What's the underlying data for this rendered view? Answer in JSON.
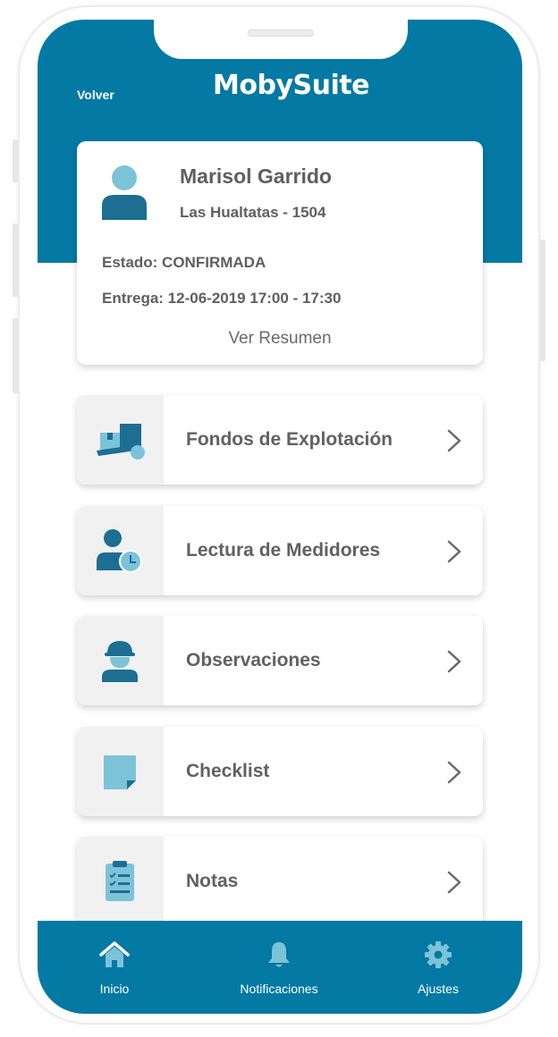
{
  "header": {
    "back_label": "Volver",
    "logo_text": "MobySuite"
  },
  "profile": {
    "name": "Marisol Garrido",
    "address": "Las Hualtatas - 1504",
    "status": "Estado: CONFIRMADA",
    "delivery": "Entrega: 12-06-2019 17:00 - 17:30",
    "summary_link": "Ver Resumen"
  },
  "menu": [
    {
      "label": "Fondos de Explotación",
      "icon": "moving-box-icon"
    },
    {
      "label": "Lectura de Medidores",
      "icon": "user-clock-icon"
    },
    {
      "label": "Observaciones",
      "icon": "worker-helmet-icon"
    },
    {
      "label": "Checklist",
      "icon": "sticky-note-icon"
    },
    {
      "label": "Notas",
      "icon": "clipboard-checklist-icon"
    }
  ],
  "tabbar": {
    "items": [
      {
        "label": "Inicio",
        "icon": "home-icon"
      },
      {
        "label": "Notificaciones",
        "icon": "bell-icon"
      },
      {
        "label": "Ajustes",
        "icon": "gear-icon"
      }
    ]
  },
  "colors": {
    "brand": "#0479a3",
    "icon_dark": "#1c6e93",
    "icon_light": "#7cc3d8",
    "text": "#5f5f5f"
  }
}
